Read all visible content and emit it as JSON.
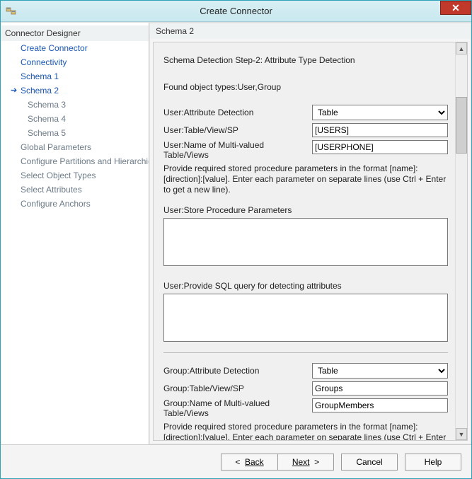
{
  "window": {
    "title": "Create Connector"
  },
  "sidebar": {
    "header": "Connector Designer",
    "items": [
      {
        "label": "Create Connector",
        "state": "normal"
      },
      {
        "label": "Connectivity",
        "state": "normal"
      },
      {
        "label": "Schema 1",
        "state": "normal"
      },
      {
        "label": "Schema 2",
        "state": "active"
      },
      {
        "label": "Schema 3",
        "state": "child"
      },
      {
        "label": "Schema 4",
        "state": "child"
      },
      {
        "label": "Schema 5",
        "state": "child"
      },
      {
        "label": "Global Parameters",
        "state": "dim"
      },
      {
        "label": "Configure Partitions and Hierarchies",
        "state": "dim"
      },
      {
        "label": "Select Object Types",
        "state": "dim"
      },
      {
        "label": "Select Attributes",
        "state": "dim"
      },
      {
        "label": "Configure Anchors",
        "state": "dim"
      }
    ]
  },
  "main": {
    "header": "Schema 2",
    "step_title": "Schema Detection Step-2: Attribute Type Detection",
    "found_line": "Found object types:User,Group",
    "user": {
      "attr_detect_label": "User:Attribute Detection",
      "attr_detect_value": "Table",
      "table_label": "User:Table/View/SP",
      "table_value": "[USERS]",
      "multi_label": "User:Name of Multi-valued Table/Views",
      "multi_value": "[USERPHONE]",
      "help": "Provide required stored procedure parameters in the format [name]:[direction]:[value]. Enter each parameter on separate lines (use Ctrl + Enter to get a new line).",
      "sp_label": "User:Store Procedure Parameters",
      "sp_value": "",
      "sql_label": "User:Provide SQL query for detecting attributes",
      "sql_value": ""
    },
    "group": {
      "attr_detect_label": "Group:Attribute Detection",
      "attr_detect_value": "Table",
      "table_label": "Group:Table/View/SP",
      "table_value": "Groups",
      "multi_label": "Group:Name of Multi-valued Table/Views",
      "multi_value": "GroupMembers",
      "help": "Provide required stored procedure parameters in the format [name]:[direction]:[value]. Enter each parameter on separate lines (use Ctrl + Enter to get a new line)."
    }
  },
  "footer": {
    "back": "Back",
    "next": "Next",
    "cancel": "Cancel",
    "help": "Help"
  }
}
